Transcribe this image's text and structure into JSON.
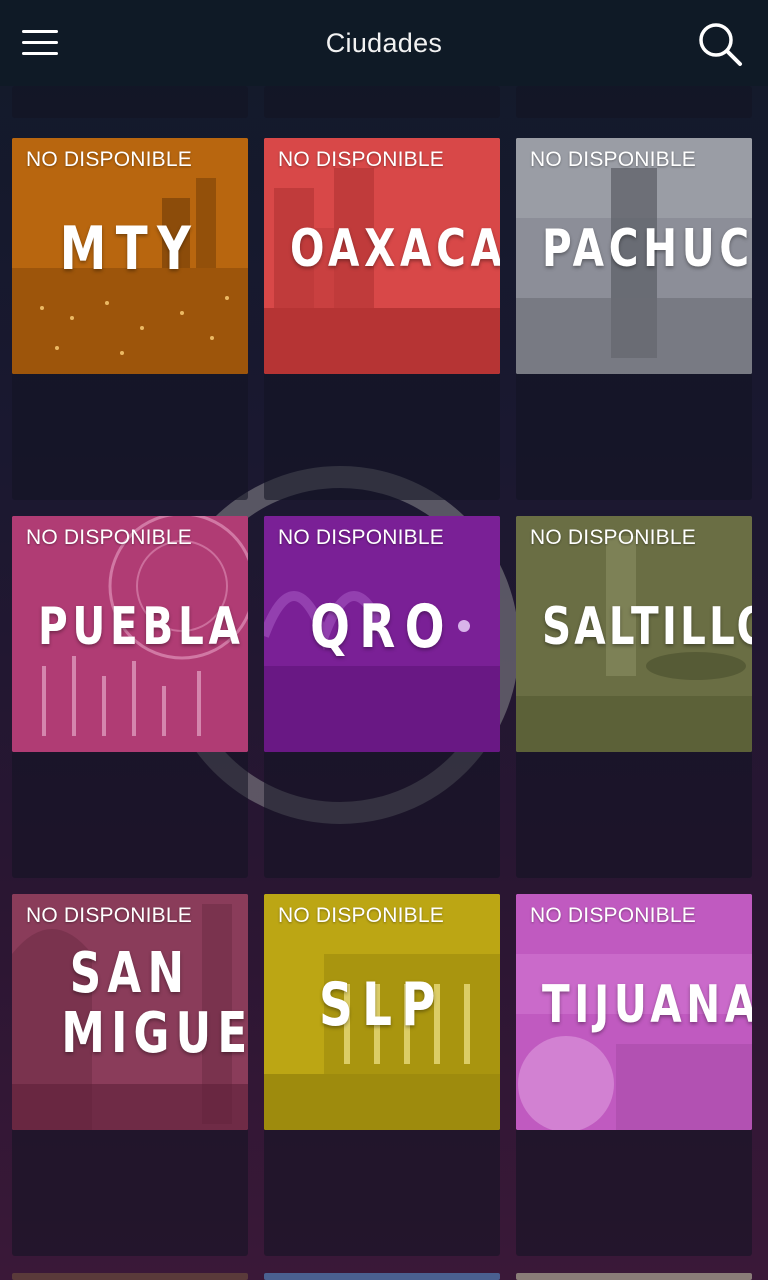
{
  "header": {
    "title": "Ciudades",
    "menu_icon": "hamburger-menu-icon",
    "search_icon": "search-icon"
  },
  "cities": [
    {
      "name": "MTY",
      "status": "NO DISPONIBLE",
      "color": "#b8660f"
    },
    {
      "name": "OAXACA",
      "status": "NO DISPONIBLE",
      "color": "#d84848"
    },
    {
      "name": "PACHUCA",
      "status": "NO DISPONIBLE",
      "color": "#8c8e98"
    },
    {
      "name": "PUEBLA",
      "status": "NO DISPONIBLE",
      "color": "#b03c74"
    },
    {
      "name": "QRO",
      "status": "NO DISPONIBLE",
      "color": "#7a2096"
    },
    {
      "name": "SALTILLO",
      "status": "NO DISPONIBLE",
      "color": "#6a6e44"
    },
    {
      "name": "SAN MIGUEL",
      "status": "NO DISPONIBLE",
      "color": "#8a3c5a"
    },
    {
      "name": "SLP",
      "status": "NO DISPONIBLE",
      "color": "#bca614"
    },
    {
      "name": "TIJUANA",
      "status": "NO DISPONIBLE",
      "color": "#c05ac0"
    }
  ],
  "colors": {
    "header_bg": "#0f1a26",
    "background_top": "#121a2a",
    "background_bottom": "#3a1838"
  }
}
